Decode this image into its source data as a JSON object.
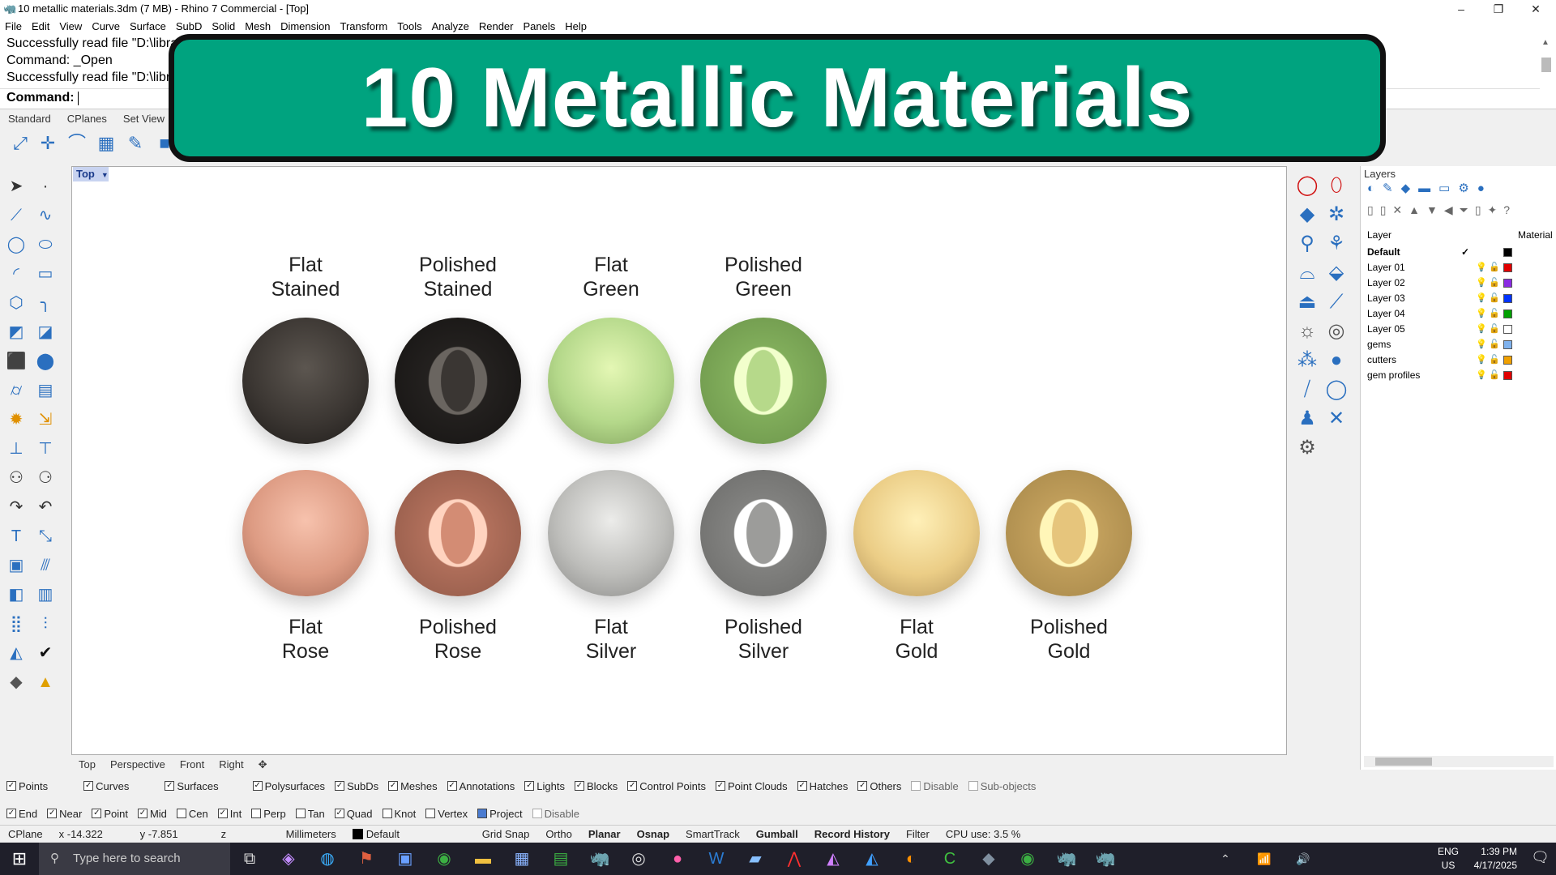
{
  "window": {
    "title": "10 metallic materials.3dm (7 MB) - Rhino 7 Commercial - [Top]",
    "controls": [
      "–",
      "❐",
      "✕"
    ]
  },
  "menu": [
    "File",
    "Edit",
    "View",
    "Curve",
    "Surface",
    "SubD",
    "Solid",
    "Mesh",
    "Dimension",
    "Transform",
    "Tools",
    "Analyze",
    "Render",
    "Panels",
    "Help"
  ],
  "command_history": [
    "Successfully read file \"D:\\libra",
    "Command: _Open",
    "Successfully read file \"D:\\libra"
  ],
  "command_prompt": "Command:",
  "toolbar_tabs": [
    "Standard",
    "CPlanes",
    "Set View"
  ],
  "banner": {
    "text": "10 Metallic Materials",
    "color": "#00a37f"
  },
  "viewport": {
    "name": "Top"
  },
  "materials": [
    {
      "label": "Flat\nStained",
      "l1": "Flat",
      "l2": "Stained",
      "style": "flat",
      "base": "#3b3632"
    },
    {
      "label": "Polished\nStained",
      "l1": "Polished",
      "l2": "Stained",
      "style": "polished",
      "base": "#3a3633"
    },
    {
      "l1": "Flat",
      "l2": "Green",
      "style": "flat",
      "base": "#b9da8a"
    },
    {
      "l1": "Polished",
      "l2": "Green",
      "style": "polished",
      "base": "#a8cf7a"
    },
    {
      "l1": "Flat",
      "l2": "Rose",
      "style": "flat",
      "base": "#e0a088"
    },
    {
      "l1": "Polished",
      "l2": "Rose",
      "style": "polished",
      "base": "#d9957e"
    },
    {
      "l1": "Flat",
      "l2": "Silver",
      "style": "flat",
      "base": "#c0c0bd"
    },
    {
      "l1": "Polished",
      "l2": "Silver",
      "style": "polished",
      "base": "#a9a9a7"
    },
    {
      "l1": "Flat",
      "l2": "Gold",
      "style": "flat",
      "base": "#ecd08c"
    },
    {
      "l1": "Polished",
      "l2": "Gold",
      "style": "polished",
      "base": "#e6c880"
    }
  ],
  "viewport_tabs": [
    "Top",
    "Perspective",
    "Front",
    "Right",
    "✥"
  ],
  "layers_panel": {
    "title": "Layers",
    "col_layer": "Layer",
    "col_material": "Material",
    "rows": [
      {
        "name": "Default",
        "color": "#000000",
        "current": true,
        "mark": "✓"
      },
      {
        "name": "Layer 01",
        "color": "#e00000"
      },
      {
        "name": "Layer 02",
        "color": "#8a2be2"
      },
      {
        "name": "Layer 03",
        "color": "#0033ff"
      },
      {
        "name": "Layer 04",
        "color": "#00a000"
      },
      {
        "name": "Layer 05",
        "color": "#ffffff"
      },
      {
        "name": "gems",
        "color": "#7fb2ee"
      },
      {
        "name": "cutters",
        "color": "#f0a000"
      },
      {
        "name": "gem profiles",
        "color": "#e00000"
      }
    ]
  },
  "filters": [
    {
      "label": "Points",
      "checked": true
    },
    {
      "label": "Curves",
      "checked": true
    },
    {
      "label": "Surfaces",
      "checked": true
    },
    {
      "label": "Polysurfaces",
      "checked": true
    },
    {
      "label": "SubDs",
      "checked": true
    },
    {
      "label": "Meshes",
      "checked": true
    },
    {
      "label": "Annotations",
      "checked": true
    },
    {
      "label": "Lights",
      "checked": true
    },
    {
      "label": "Blocks",
      "checked": true
    },
    {
      "label": "Control Points",
      "checked": true
    },
    {
      "label": "Point Clouds",
      "checked": true
    },
    {
      "label": "Hatches",
      "checked": true
    },
    {
      "label": "Others",
      "checked": true
    },
    {
      "label": "Disable",
      "checked": false
    },
    {
      "label": "Sub-objects",
      "checked": false
    }
  ],
  "osnaps": [
    {
      "label": "End",
      "checked": true
    },
    {
      "label": "Near",
      "checked": true
    },
    {
      "label": "Point",
      "checked": true
    },
    {
      "label": "Mid",
      "checked": true
    },
    {
      "label": "Cen",
      "checked": false
    },
    {
      "label": "Int",
      "checked": true
    },
    {
      "label": "Perp",
      "checked": false
    },
    {
      "label": "Tan",
      "checked": false
    },
    {
      "label": "Quad",
      "checked": true
    },
    {
      "label": "Knot",
      "checked": false
    },
    {
      "label": "Vertex",
      "checked": false
    },
    {
      "label": "Project",
      "checked": true
    },
    {
      "label": "Disable",
      "checked": false
    }
  ],
  "status": {
    "cplane": "CPlane",
    "x": "x -14.322",
    "y": "y -7.851",
    "z": "z",
    "units": "Millimeters",
    "layer": "Default",
    "grid_snap": "Grid Snap",
    "ortho": "Ortho",
    "planar": "Planar",
    "osnap": "Osnap",
    "smarttrack": "SmartTrack",
    "gumball": "Gumball",
    "record_history": "Record History",
    "filter": "Filter",
    "cpu": "CPU use: 3.5 %"
  },
  "taskbar": {
    "search_placeholder": "Type here to search",
    "lang1": "ENG",
    "lang2": "US",
    "time": "1:39 PM",
    "date": "4/17/2025"
  }
}
